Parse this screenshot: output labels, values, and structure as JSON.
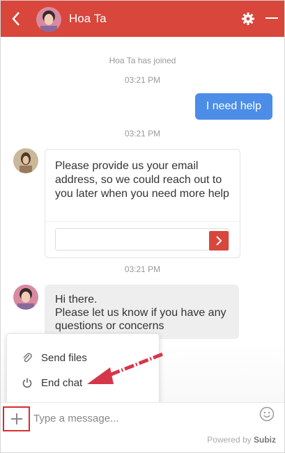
{
  "header": {
    "contact_name": "Hoa Ta",
    "accent_color": "#d9463b",
    "icons": [
      "back-icon",
      "gear-icon",
      "minimize-icon"
    ]
  },
  "chat": {
    "system_message": "Hoa Ta has joined",
    "time_1": "03:21 PM",
    "outgoing_message": "I need help",
    "time_2": "03:21 PM",
    "email_request": "Please provide us your email address, so we could reach out to you later when you need more help",
    "email_input_value": "",
    "time_3": "03:21 PM",
    "incoming_line_1": "Hi there.",
    "incoming_line_2": "Please let us know if you have any questions or concerns"
  },
  "menu": {
    "send_files": "Send files",
    "end_chat": "End chat"
  },
  "composer": {
    "placeholder": "Type a message...",
    "value": ""
  },
  "footer": {
    "powered_by": "Powered by",
    "brand": "Subiz"
  }
}
